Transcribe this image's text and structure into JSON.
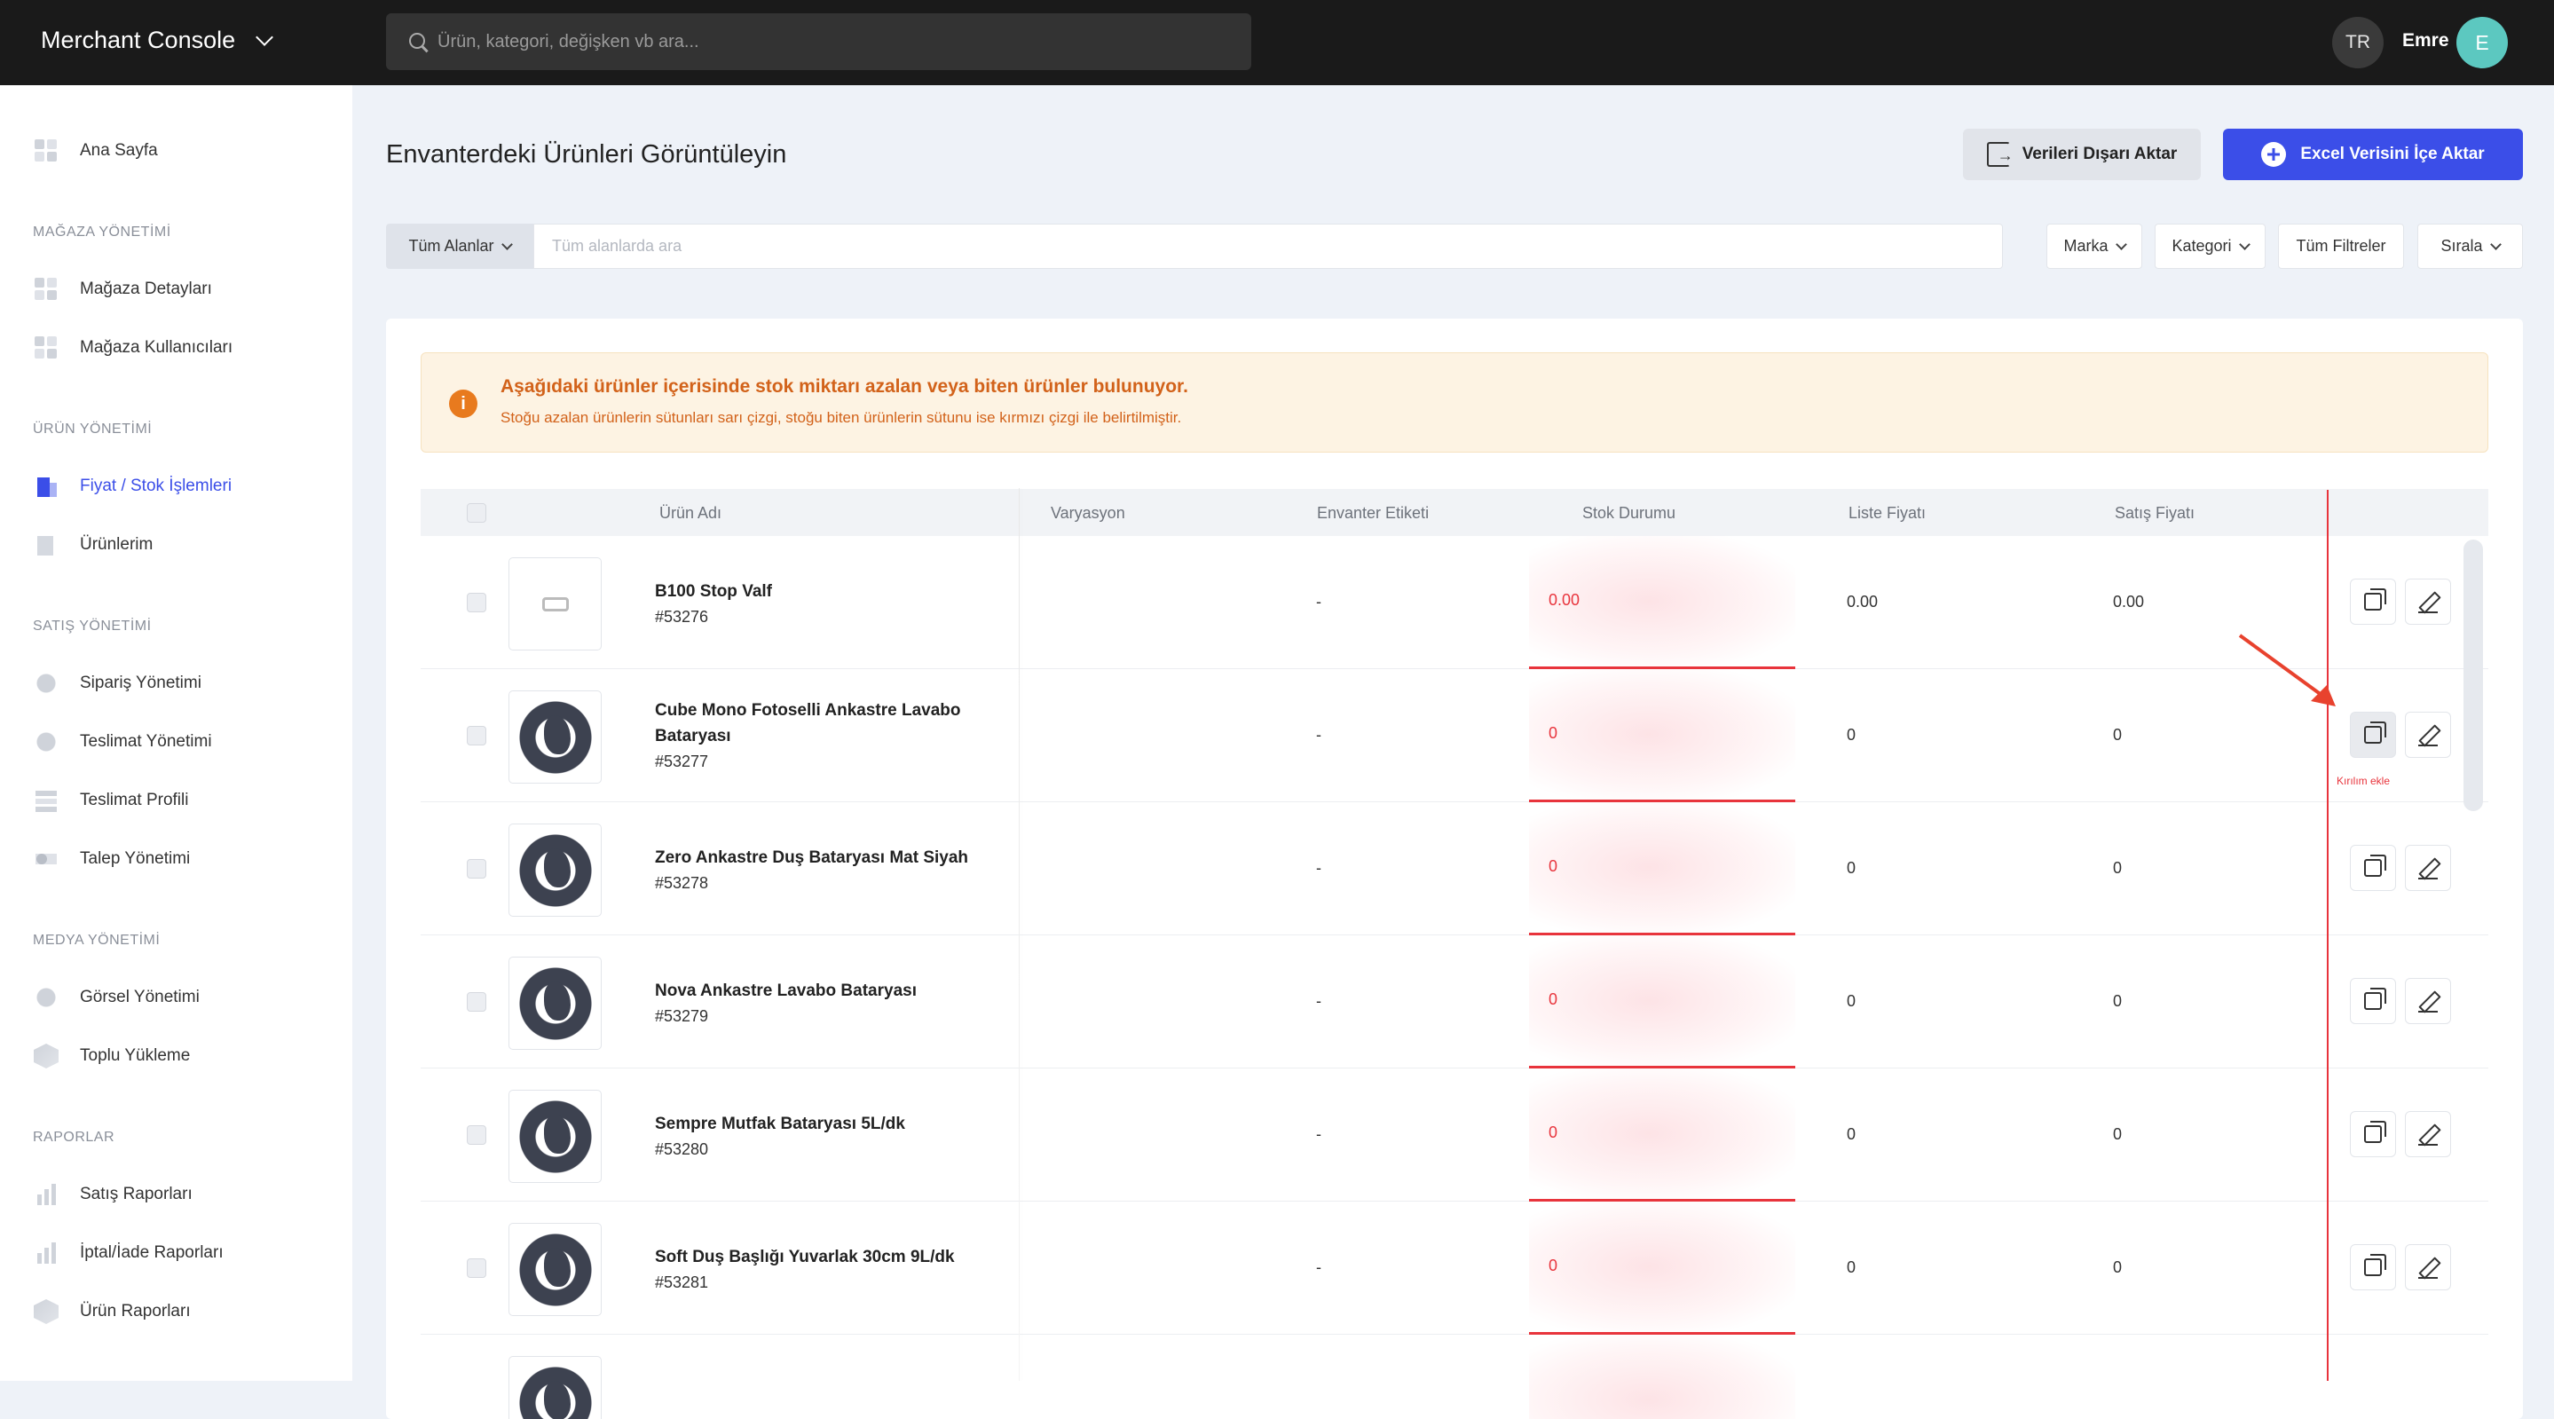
{
  "topbar": {
    "brand": "Merchant Console",
    "search_placeholder": "Ürün, kategori, değişken vb ara...",
    "lang": "TR",
    "user_name": "Emre",
    "avatar_initial": "E"
  },
  "sidebar": {
    "home": "Ana Sayfa",
    "sections": [
      {
        "title": "MAĞAZA YÖNETİMİ",
        "items": [
          "Mağaza Detayları",
          "Mağaza Kullanıcıları"
        ]
      },
      {
        "title": "ÜRÜN YÖNETİMİ",
        "items": [
          "Fiyat / Stok İşlemleri",
          "Ürünlerim"
        ]
      },
      {
        "title": "SATIŞ YÖNETİMİ",
        "items": [
          "Sipariş Yönetimi",
          "Teslimat Yönetimi",
          "Teslimat Profili",
          "Talep Yönetimi"
        ]
      },
      {
        "title": "MEDYA YÖNETİMİ",
        "items": [
          "Görsel Yönetimi",
          "Toplu Yükleme"
        ]
      },
      {
        "title": "RAPORLAR",
        "items": [
          "Satış Raporları",
          "İptal/İade Raporları",
          "Ürün Raporları"
        ]
      }
    ]
  },
  "main": {
    "title": "Envanterdeki Ürünleri Görüntüleyin",
    "export_label": "Verileri Dışarı Aktar",
    "import_label": "Excel Verisini İçe Aktar",
    "filter_select": "Tüm Alanlar",
    "filter_placeholder": "Tüm alanlarda ara",
    "filters": {
      "brand": "Marka",
      "category": "Kategori",
      "all": "Tüm Filtreler",
      "sort": "Sırala"
    }
  },
  "alert": {
    "title": "Aşağıdaki ürünler içerisinde stok miktarı azalan veya biten ürünler bulunuyor.",
    "desc": "Stoğu azalan ürünlerin sütunları sarı çizgi, stoğu biten ürünlerin sütunu ise kırmızı çizgi ile belirtilmiştir."
  },
  "table": {
    "headers": [
      "Ürün Adı",
      "Varyasyon",
      "Envanter Etiketi",
      "Stok Durumu",
      "Liste Fiyatı",
      "Satış Fiyatı"
    ],
    "rows": [
      {
        "name": "B100 Stop Valf",
        "sku": "#53276",
        "tag": "-",
        "stock": "0.00",
        "list": "0.00",
        "sale": "0.00"
      },
      {
        "name": "Cube Mono Fotoselli Ankastre Lavabo Bataryası",
        "sku": "#53277",
        "tag": "-",
        "stock": "0",
        "list": "0",
        "sale": "0"
      },
      {
        "name": "Zero Ankastre Duş Bataryası Mat Siyah",
        "sku": "#53278",
        "tag": "-",
        "stock": "0",
        "list": "0",
        "sale": "0"
      },
      {
        "name": "Nova Ankastre Lavabo Bataryası",
        "sku": "#53279",
        "tag": "-",
        "stock": "0",
        "list": "0",
        "sale": "0"
      },
      {
        "name": "Sempre Mutfak Bataryası 5L/dk",
        "sku": "#53280",
        "tag": "-",
        "stock": "0",
        "list": "0",
        "sale": "0"
      },
      {
        "name": "Soft Duş Başlığı Yuvarlak 30cm 9L/dk",
        "sku": "#53281",
        "tag": "-",
        "stock": "0",
        "list": "0",
        "sale": "0"
      }
    ],
    "tooltip": "Kırılım ekle"
  },
  "colors": {
    "accent": "#3b4ee8",
    "danger": "#e8343c",
    "warning": "#d2621a"
  }
}
